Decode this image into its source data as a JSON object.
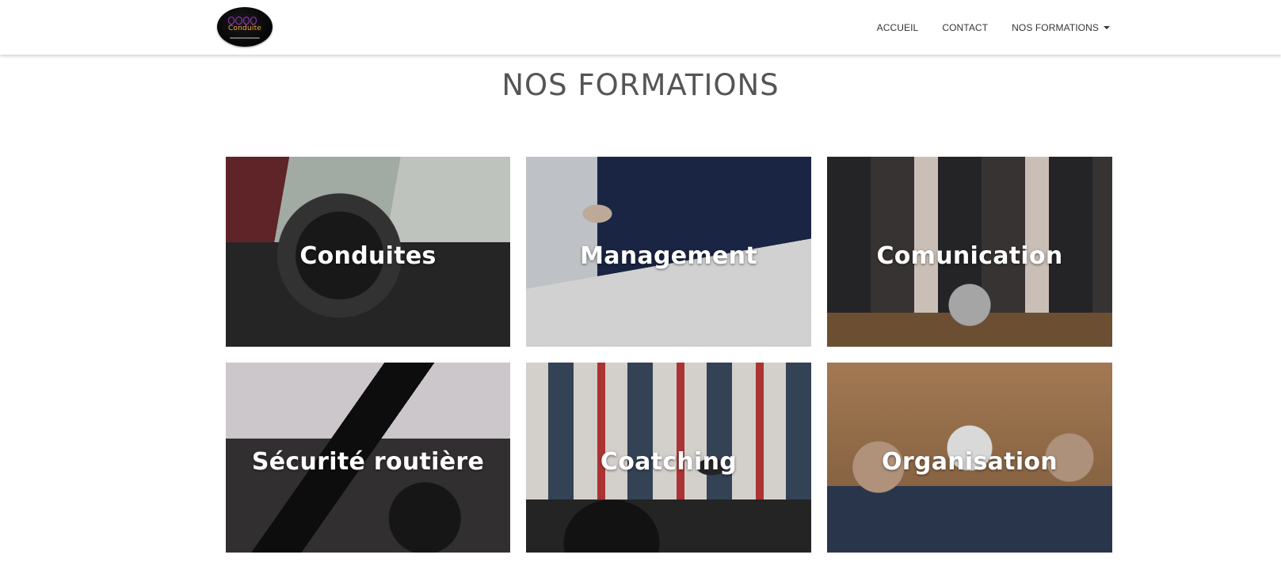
{
  "header": {
    "logo": {
      "text": "Conduite",
      "icon": "olympic-rings-logo-icon"
    },
    "nav": [
      {
        "label": "ACCUEIL"
      },
      {
        "label": "CONTACT"
      },
      {
        "label": "NOS FORMATIONS",
        "icon": "caret-down-icon"
      }
    ]
  },
  "main": {
    "title": "NOS FORMATIONS",
    "formations": [
      {
        "label": "Conduites"
      },
      {
        "label": "Management"
      },
      {
        "label": "Comunication"
      },
      {
        "label": "Sécurité routière"
      },
      {
        "label": "Coatching"
      },
      {
        "label": "Organisation"
      }
    ]
  },
  "colors": {
    "title": "#555555",
    "nav_text": "#333333",
    "card_label": "#ffffff",
    "logo_accent": "#a333d6",
    "logo_text": "#f2a53a"
  }
}
